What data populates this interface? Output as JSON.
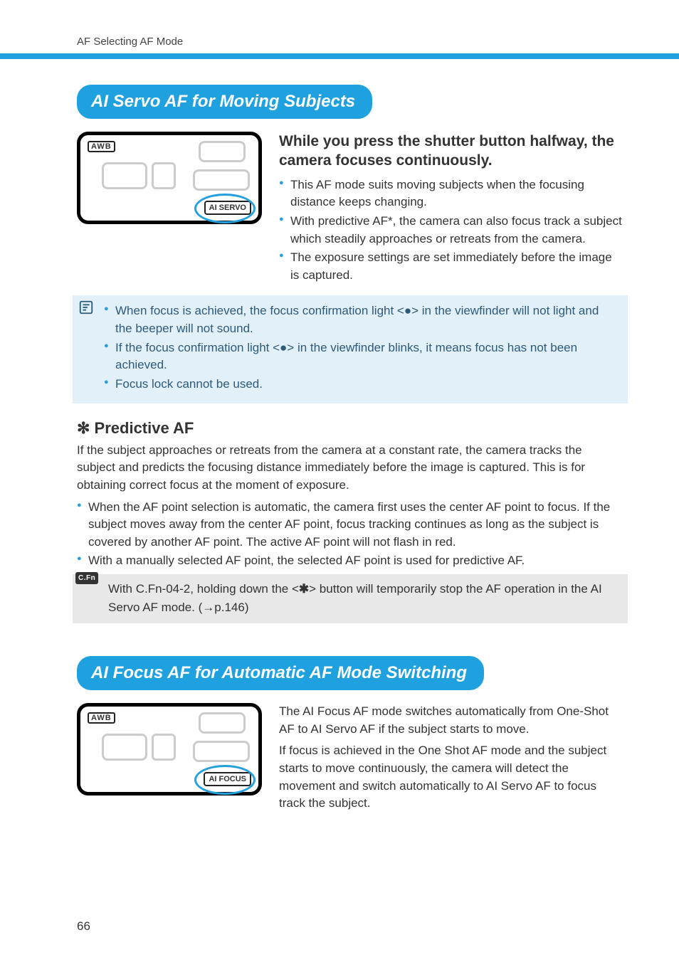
{
  "running_head": "AF Selecting AF Mode",
  "page_number": "66",
  "section1": {
    "title": "AI Servo AF for Moving Subjects",
    "lcd_awb": "AWB",
    "lcd_mode": "AI SERVO",
    "heading": "While you press the shutter button halfway, the camera focuses continuously.",
    "bullets": [
      "This AF mode suits moving subjects when the focusing distance keeps changing.",
      "With predictive AF*, the camera can also focus track a subject which steadily approaches or retreats from the camera.",
      "The exposure settings are set immediately before the image is captured."
    ],
    "notes": [
      "When focus is achieved, the focus confirmation light <●> in the viewfinder will not light and the beeper will not sound.",
      "If the focus confirmation light <●> in the viewfinder blinks, it means focus has not been achieved.",
      "Focus lock cannot be used."
    ]
  },
  "predictive": {
    "title_prefix": "✻",
    "title": " Predictive AF",
    "para": "If the subject approaches or retreats from the camera at a constant rate, the camera tracks the subject and predicts the focusing distance immediately before the image is captured. This is for obtaining correct focus at the moment of exposure.",
    "bullets": [
      "When the AF point selection is automatic, the camera first uses the center AF point to focus. If the subject moves away from the center AF point, focus tracking continues as long as the subject is covered by another AF point. The active AF point will not flash in red.",
      "With a manually selected AF point, the selected AF point is used for predictive AF."
    ]
  },
  "cfn": {
    "badge": "C.Fn",
    "text_a": "With C.Fn-04-2, holding down the <",
    "star": "✱",
    "text_b": "> button will temporarily stop the AF operation in the AI Servo AF mode. (→p.146)"
  },
  "section2": {
    "title": "AI Focus AF for Automatic AF Mode Switching",
    "lcd_awb": "AWB",
    "lcd_mode": "AI FOCUS",
    "para1": "The AI Focus AF mode switches automatically from One-Shot AF to AI Servo AF if the subject starts to move.",
    "para2": "If focus is achieved in the One Shot AF mode and the subject starts to move continuously, the camera will detect the movement and switch automatically to AI Servo AF to focus track the subject."
  }
}
